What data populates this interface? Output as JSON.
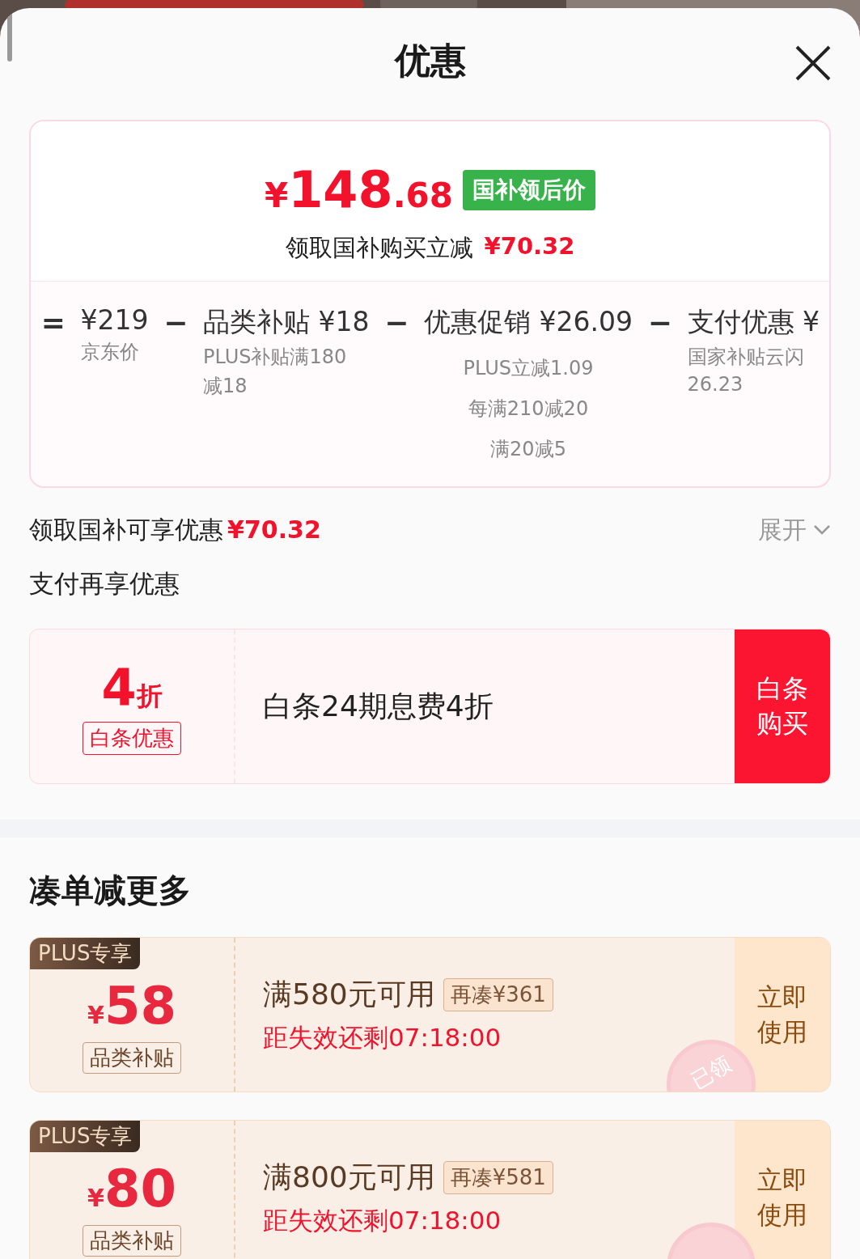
{
  "sheet": {
    "title": "优惠"
  },
  "price_card": {
    "price_symbol": "¥",
    "price_int": "148",
    "price_dec": ".68",
    "tag": "国补领后价",
    "saving_label": "领取国补购买立减",
    "saving_amount": "¥70.32",
    "breakdown": [
      {
        "op": "=",
        "title": "¥219",
        "notes": [
          "京东价"
        ]
      },
      {
        "op": "−",
        "title": "品类补贴 ¥18",
        "notes": [
          "PLUS补贴满180",
          "减18"
        ]
      },
      {
        "op": "−",
        "title": "优惠促销 ¥26.09",
        "notes": [
          "PLUS立减1.09",
          "每满210减20",
          "满20减5"
        ]
      },
      {
        "op": "−",
        "title": "支付优惠 ¥",
        "notes": [
          "国家补贴云闪",
          "26.23"
        ]
      }
    ]
  },
  "subsidy_row": {
    "label": "领取国补可享优惠",
    "amount": "¥70.32",
    "toggle": "展开",
    "expanded": false
  },
  "pay_section": {
    "title": "支付再享优惠",
    "offer": {
      "big": "4",
      "unit": "折",
      "tag": "白条优惠",
      "text": "白条24期息费4折",
      "button": "白条购买"
    }
  },
  "more_section": {
    "title": "凑单减更多",
    "coupons": [
      {
        "badge": "PLUS专享",
        "symbol": "¥",
        "amount": "58",
        "tag": "品类补贴",
        "condition": "满580元可用",
        "gap": "再凑¥361",
        "countdown": "距失效还剩07:18:00",
        "button": "立即使用",
        "claimed": true,
        "stamp": "已领"
      },
      {
        "badge": "PLUS专享",
        "symbol": "¥",
        "amount": "80",
        "tag": "品类补贴",
        "condition": "满800元可用",
        "gap": "再凑¥581",
        "countdown": "距失效还剩07:18:00",
        "button": "立即使用",
        "claimed": true
      }
    ]
  }
}
